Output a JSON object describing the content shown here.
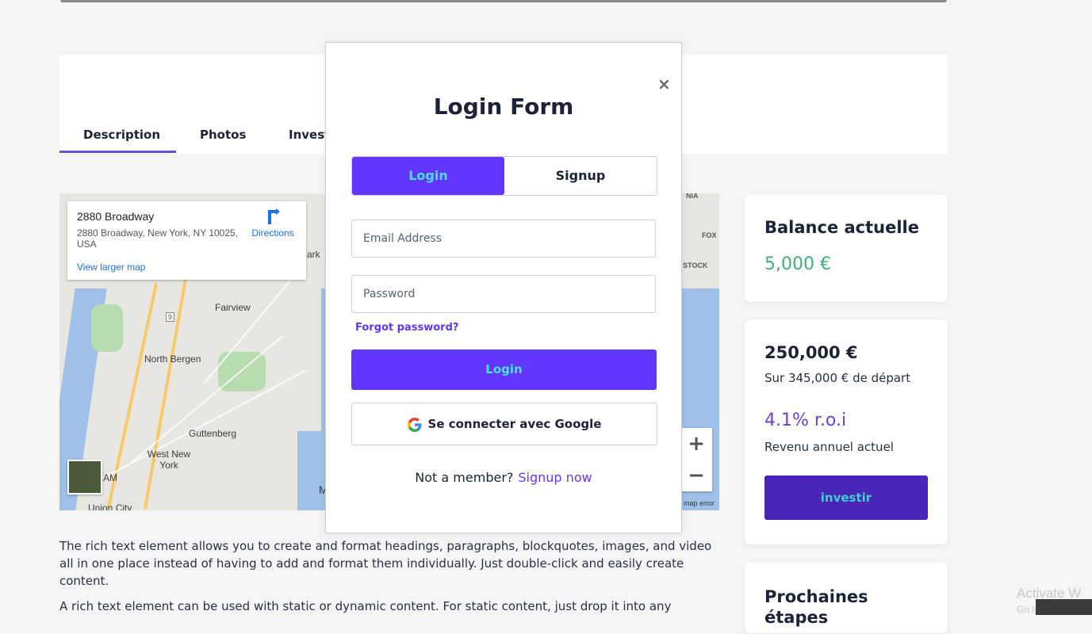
{
  "tabs": [
    "Description",
    "Photos",
    "Invest"
  ],
  "map": {
    "place_title": "2880 Broadway",
    "place_address": "2880 Broadway, New York, NY 10025, USA",
    "directions_label": "Directions",
    "larger_map_label": "View larger map",
    "zoom_in": "+",
    "zoom_out": "−",
    "map_error": "map error",
    "labels": {
      "fairview": "Fairview",
      "north_bergen": "North Bergen",
      "guttenberg": "Guttenberg",
      "west_new_york": "West New York",
      "union_city": "Union City",
      "stock": "STOCK",
      "fox": "FOX",
      "nia": "NIA",
      "ark": "ark",
      "route_9": "9",
      "m": "M",
      "am": "AM"
    }
  },
  "body_text": {
    "p1": "The rich text element allows you to create and format headings, paragraphs, blockquotes, images, and video all in one place instead of having to add and format them individually. Just double-click and easily create content.",
    "p2": "A rich text element can be used with static or dynamic content. For static content, just drop it into any"
  },
  "sidebar": {
    "balance_title": "Balance actuelle",
    "balance_value": "5,000 €",
    "invest_value": "250,000 €",
    "invest_sub": "Sur 345,000 € de départ",
    "roi_value": "4.1% r.o.i",
    "roi_sub": "Revenu annuel actuel",
    "invest_button": "investir",
    "next_steps_title": "Prochaines étapes"
  },
  "modal": {
    "close": "×",
    "title": "Login Form",
    "switch_login": "Login",
    "switch_signup": "Signup",
    "email_placeholder": "Email Address",
    "password_placeholder": "Password",
    "forgot": "Forgot password?",
    "login_button": "Login",
    "google_button": "Se connecter avec Google",
    "not_member": "Not a member?",
    "signup_link": "Signup now"
  },
  "watermark": {
    "line1": "Activate W",
    "line2": "Go to Settin"
  },
  "colors": {
    "primary": "#6236ff",
    "accent_text": "#4ae0e0",
    "balance_green": "#3cb371",
    "invest_button": "#4a25b8"
  }
}
